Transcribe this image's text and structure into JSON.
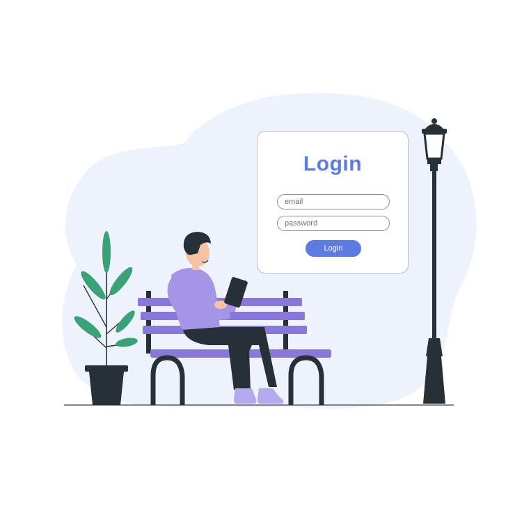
{
  "login_form": {
    "title": "Login",
    "email_placeholder": "email",
    "password_placeholder": "password",
    "submit_label": "Login"
  },
  "colors": {
    "accent": "#5b7be0",
    "bench": "#8a78d6",
    "shirt": "#a694e6",
    "dark": "#263036",
    "leaf": "#3aa276",
    "background_blob": "#edf2fc"
  }
}
